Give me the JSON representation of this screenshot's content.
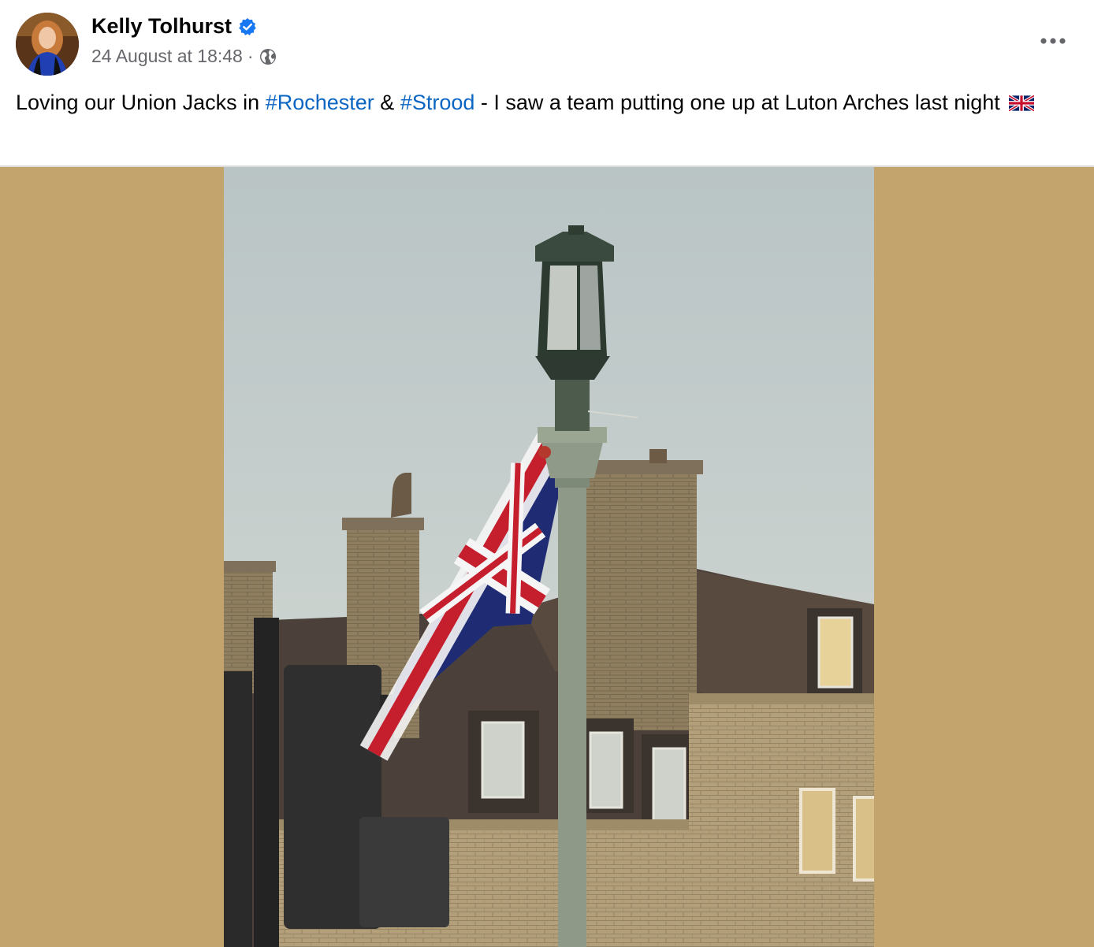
{
  "post": {
    "author": "Kelly Tolhurst",
    "timestamp": "24 August at 18:48",
    "separator": "·",
    "audience_icon": "globe-icon",
    "verified_icon": "verified-badge-icon",
    "more_icon": "more-options-icon",
    "text_before": "Loving our Union Jacks in",
    "hashtag_1": "#Rochester",
    "text_and": "&",
    "hashtag_2": "#Strood",
    "text_after": "- I saw a team putting one up at Luton Arches last night",
    "emoji": "flag-united-kingdom-icon"
  },
  "colors": {
    "hashtag": "#0a66c2",
    "verified": "#1877f2",
    "media_background": "#c4a46d"
  }
}
